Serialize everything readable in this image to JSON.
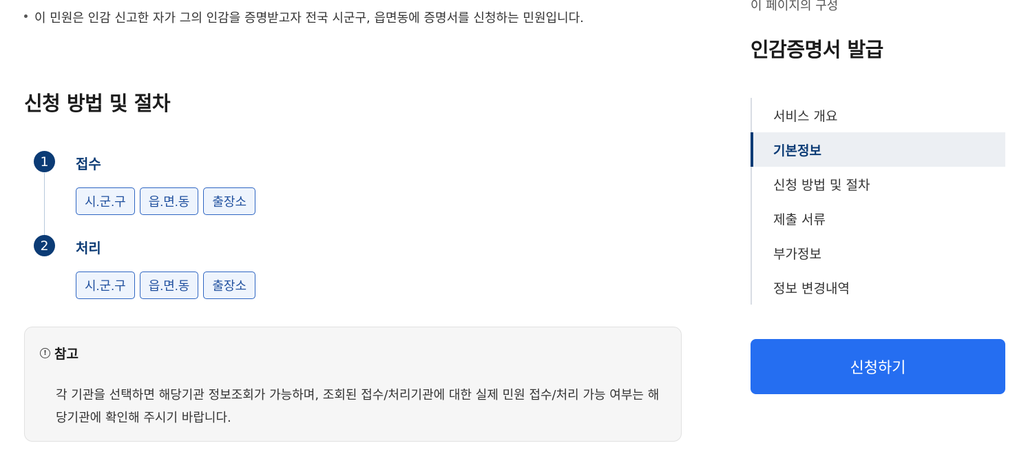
{
  "intro": "이 민원은 인감 신고한 자가 그의 인감을 증명받고자 전국 시군구, 읍면동에 증명서를 신청하는 민원입니다.",
  "section": {
    "title": "신청 방법 및 절차"
  },
  "steps": [
    {
      "num": "1",
      "title": "접수",
      "chips": [
        "시.군.구",
        "읍.면.동",
        "출장소"
      ]
    },
    {
      "num": "2",
      "title": "처리",
      "chips": [
        "시.군.구",
        "읍.면.동",
        "출장소"
      ]
    }
  ],
  "note": {
    "title": "참고",
    "icon": "exclamation-circle-icon",
    "body": "각 기관을 선택하면 해당기관 정보조회가 가능하며, 조회된 접수/처리기관에 대한 실제 민원 접수/처리 가능 여부는 해당기관에 확인해 주시기 바랍니다."
  },
  "aside": {
    "subtitle": "이 페이지의 구성",
    "title": "인감증명서 발급",
    "toc": [
      {
        "label": "서비스 개요",
        "active": false
      },
      {
        "label": "기본정보",
        "active": true
      },
      {
        "label": "신청 방법 및 절차",
        "active": false
      },
      {
        "label": "제출 서류",
        "active": false
      },
      {
        "label": "부가정보",
        "active": false
      },
      {
        "label": "정보 변경내역",
        "active": false
      }
    ],
    "apply_label": "신청하기"
  },
  "colors": {
    "primary_navy": "#0b3b75",
    "chip_border": "#2f66c2",
    "chip_bg": "#eef4fd",
    "apply_button": "#256ef1",
    "toc_active_bg": "#eceff3"
  }
}
